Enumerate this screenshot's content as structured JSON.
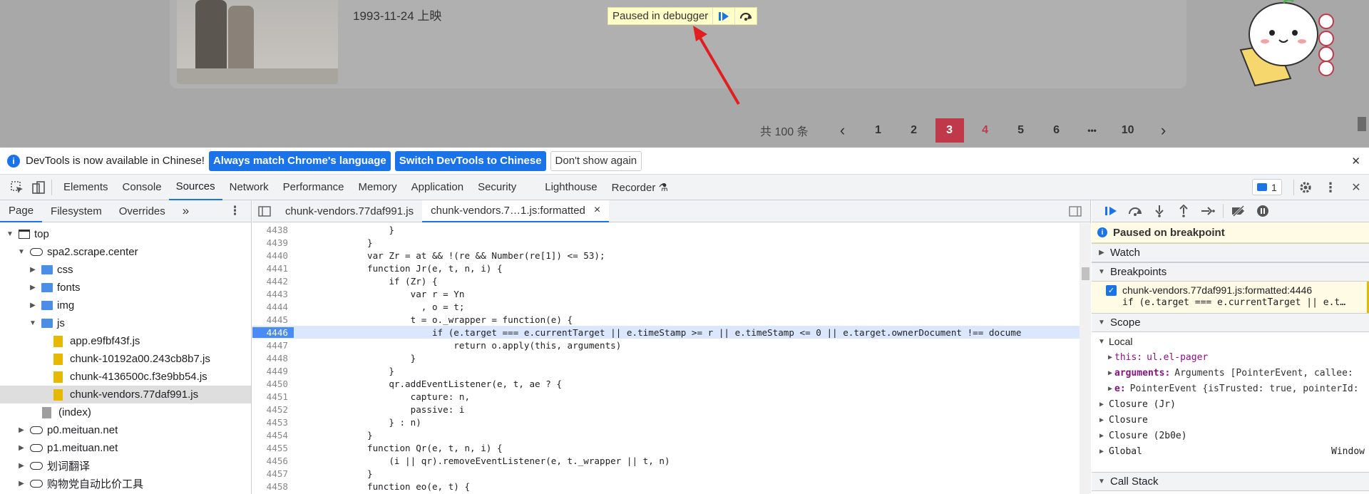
{
  "website": {
    "release_date": "1993-11-24 上映",
    "paused_pill": "Paused in debugger",
    "pager": {
      "total": "共 100 条",
      "prev": "‹",
      "pages": [
        "1",
        "2",
        "3",
        "4",
        "5",
        "6",
        "•••",
        "10"
      ],
      "active": "3",
      "next": "›"
    }
  },
  "infobar": {
    "message": "DevTools is now available in Chinese!",
    "btn_match": "Always match Chrome's language",
    "btn_switch": "Switch DevTools to Chinese",
    "btn_dont": "Don't show again",
    "close": "✕"
  },
  "toolbar": {
    "tabs": [
      "Elements",
      "Console",
      "Sources",
      "Network",
      "Performance",
      "Memory",
      "Application",
      "Security",
      "Lighthouse",
      "Recorder ⚗"
    ],
    "active": "Sources",
    "issues_count": "1"
  },
  "navigator": {
    "tabs": [
      "Page",
      "Filesystem",
      "Overrides"
    ],
    "more": "»",
    "tree": [
      {
        "label": "top",
        "indent": 0,
        "type": "frame",
        "open": true
      },
      {
        "label": "spa2.scrape.center",
        "indent": 1,
        "type": "cloud",
        "open": true
      },
      {
        "label": "css",
        "indent": 2,
        "type": "folder",
        "open": false
      },
      {
        "label": "fonts",
        "indent": 2,
        "type": "folder",
        "open": false
      },
      {
        "label": "img",
        "indent": 2,
        "type": "folder",
        "open": false
      },
      {
        "label": "js",
        "indent": 2,
        "type": "folder",
        "open": true
      },
      {
        "label": "app.e9fbf43f.js",
        "indent": 3,
        "type": "js"
      },
      {
        "label": "chunk-10192a00.243cb8b7.js",
        "indent": 3,
        "type": "js"
      },
      {
        "label": "chunk-4136500c.f3e9bb54.js",
        "indent": 3,
        "type": "js"
      },
      {
        "label": "chunk-vendors.77daf991.js",
        "indent": 3,
        "type": "js",
        "selected": true
      },
      {
        "label": "(index)",
        "indent": 2,
        "type": "doc"
      },
      {
        "label": "p0.meituan.net",
        "indent": 1,
        "type": "cloud",
        "open": false
      },
      {
        "label": "p1.meituan.net",
        "indent": 1,
        "type": "cloud",
        "open": false
      },
      {
        "label": "划词翻译",
        "indent": 1,
        "type": "cloud",
        "open": false
      },
      {
        "label": "购物党自动比价工具",
        "indent": 1,
        "type": "cloud",
        "open": false
      }
    ]
  },
  "editor": {
    "tabs": [
      "chunk-vendors.77daf991.js",
      "chunk-vendors.7…1.js:formatted"
    ],
    "active_tab": "chunk-vendors.7…1.js:formatted",
    "tab_close": "×",
    "exec_line": "4446",
    "lines": [
      {
        "n": "4438",
        "t": "                }"
      },
      {
        "n": "4439",
        "t": "            }"
      },
      {
        "n": "4440",
        "t": "            var Zr = at && !(re && Number(re[1]) <= 53);"
      },
      {
        "n": "4441",
        "t": "            function Jr(e, t, n, i) {"
      },
      {
        "n": "4442",
        "t": "                if (Zr) {"
      },
      {
        "n": "4443",
        "t": "                    var r = Yn"
      },
      {
        "n": "4444",
        "t": "                      , o = t;"
      },
      {
        "n": "4445",
        "t": "                    t = o._wrapper = function(e) {"
      },
      {
        "n": "4446",
        "t": "                        if (e.target === e.currentTarget || e.timeStamp >= r || e.timeStamp <= 0 || e.target.ownerDocument !== docume"
      },
      {
        "n": "4447",
        "t": "                            return o.apply(this, arguments)"
      },
      {
        "n": "4448",
        "t": "                    }"
      },
      {
        "n": "4449",
        "t": "                }"
      },
      {
        "n": "4450",
        "t": "                qr.addEventListener(e, t, ae ? {"
      },
      {
        "n": "4451",
        "t": "                    capture: n,"
      },
      {
        "n": "4452",
        "t": "                    passive: i"
      },
      {
        "n": "4453",
        "t": "                } : n)"
      },
      {
        "n": "4454",
        "t": "            }"
      },
      {
        "n": "4455",
        "t": "            function Qr(e, t, n, i) {"
      },
      {
        "n": "4456",
        "t": "                (i || qr).removeEventListener(e, t._wrapper || t, n)"
      },
      {
        "n": "4457",
        "t": "            }"
      },
      {
        "n": "4458",
        "t": "            function eo(e, t) {"
      }
    ]
  },
  "debugger": {
    "paused_msg": "Paused on breakpoint",
    "sections": {
      "watch": "Watch",
      "breakpoints": "Breakpoints",
      "scope": "Scope",
      "callstack": "Call Stack"
    },
    "breakpoint": {
      "file": "chunk-vendors.77daf991.js:formatted:4446",
      "code": "if (e.target === e.currentTarget || e.t…"
    },
    "scope": {
      "local": "Local",
      "this_key": "this:",
      "this_val": "ul.el-pager",
      "args_key": "arguments:",
      "args_val": "Arguments [PointerEvent, callee:",
      "e_key": "e:",
      "e_val": "PointerEvent {isTrusted: true, pointerId:",
      "closure_jr": "Closure (Jr)",
      "closure": "Closure",
      "closure_2b0e": "Closure (2b0e)",
      "global": "Global",
      "global_val": "Window"
    }
  },
  "colors": {
    "accent": "#1a73e8",
    "pager_active": "#c0394b",
    "pill_bg": "#ffffc7",
    "arrow": "#e02020"
  }
}
